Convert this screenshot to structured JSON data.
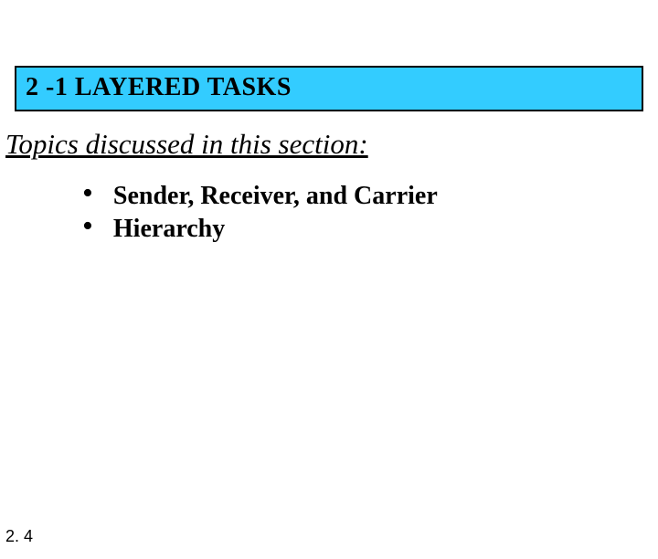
{
  "title": {
    "number": "2 -1",
    "text": "LAYERED TASKS",
    "full": "2 -1   LAYERED TASKS"
  },
  "section_heading": "Topics discussed in this section:",
  "bullets": [
    "Sender, Receiver, and Carrier",
    "Hierarchy"
  ],
  "page_number": "2. 4",
  "colors": {
    "title_bg": "#33ccff",
    "border": "#000000"
  }
}
